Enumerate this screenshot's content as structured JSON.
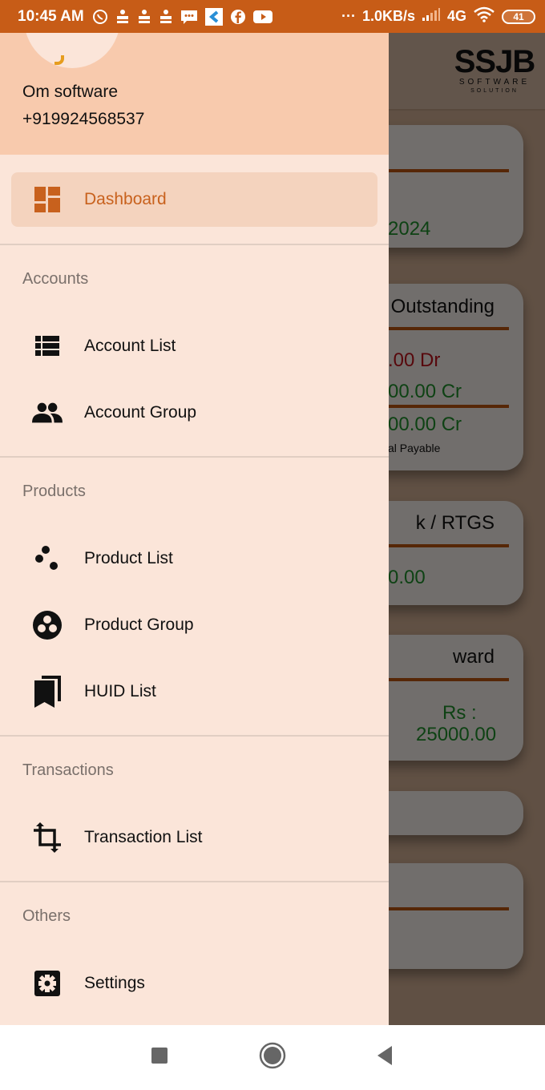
{
  "status_bar": {
    "time": "10:45 AM",
    "notification_icons": [
      "whatsapp-icon",
      "app-notification-icon",
      "app-notification-icon",
      "app-notification-icon",
      "message-icon",
      "app-icon",
      "facebook-icon",
      "youtube-icon"
    ],
    "more": "···",
    "network_speed": "1.0KB/s",
    "network_type": "4G",
    "battery": "41"
  },
  "drawer": {
    "header": {
      "user_name": "Om software",
      "phone": "+919924568537"
    },
    "active_item": {
      "label": "Dashboard",
      "icon": "dashboard-icon"
    },
    "sections": [
      {
        "title": "Accounts",
        "items": [
          {
            "label": "Account List",
            "icon": "list-icon"
          },
          {
            "label": "Account Group",
            "icon": "people-icon"
          }
        ]
      },
      {
        "title": "Products",
        "items": [
          {
            "label": "Product List",
            "icon": "scatter-dots-icon"
          },
          {
            "label": "Product Group",
            "icon": "circle-dots-icon"
          },
          {
            "label": "HUID List",
            "icon": "bookmarks-icon"
          }
        ]
      },
      {
        "title": "Transactions",
        "items": [
          {
            "label": "Transaction List",
            "icon": "crop-rotate-icon"
          }
        ]
      },
      {
        "title": "Others",
        "items": [
          {
            "label": "Settings",
            "icon": "settings-icon"
          }
        ]
      }
    ],
    "colors": {
      "accent": "#C8611D",
      "header_bg": "#F8CAAD",
      "drawer_bg": "#FBE5D9",
      "active_bg": "#F4D3BE"
    }
  },
  "background_app": {
    "logo": {
      "main": "SSJB",
      "line1": "SOFTWARE",
      "line2": "SOLUTION"
    },
    "cards": [
      {
        "title": "",
        "value": "2024"
      },
      {
        "title": "Outstanding",
        "values": [
          ".00 Dr",
          "00.00 Cr",
          "00.00 Cr"
        ],
        "caption": "al Payable"
      },
      {
        "title": "k / RTGS",
        "value": "0.00"
      },
      {
        "title": "ward",
        "value_line1": "Rs :",
        "value_line2": "25000.00"
      }
    ]
  },
  "nav_bar": {
    "buttons": [
      "recents-button",
      "home-button",
      "back-button"
    ]
  }
}
